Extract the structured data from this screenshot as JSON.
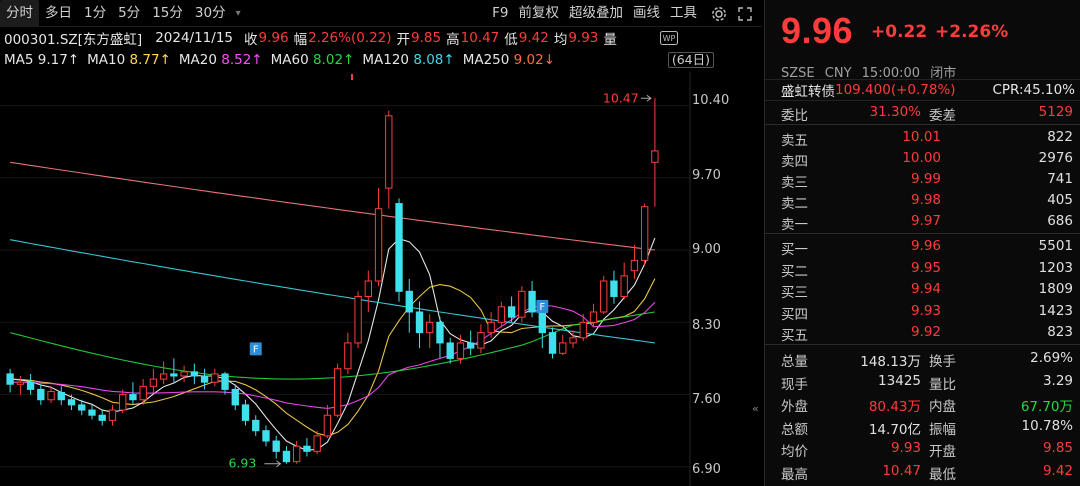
{
  "toolbar": {
    "tabs": [
      "分时",
      "多日",
      "1分",
      "5分",
      "15分",
      "30分"
    ],
    "more": "▾",
    "right_items": [
      "F9",
      "前复权",
      "超级叠加",
      "画线",
      "工具"
    ]
  },
  "info": {
    "code": "000301.SZ[东方盛虹]",
    "date": "2024/11/15",
    "close_label": "收",
    "close": "9.96",
    "range_label": "幅",
    "range": "2.26%(0.22)",
    "open_label": "开",
    "open": "9.85",
    "high_label": "高",
    "high": "10.47",
    "low_label": "低",
    "low": "9.42",
    "avg_label": "均",
    "avg": "9.93",
    "vol_label": "量"
  },
  "ma": [
    {
      "label": "MA5",
      "value": "9.17↑",
      "color": "#ffffff"
    },
    {
      "label": "MA10",
      "value": "8.77↑",
      "color": "#ffd84d"
    },
    {
      "label": "MA20",
      "value": "8.52↑",
      "color": "#ff4dff"
    },
    {
      "label": "MA60",
      "value": "8.02↑",
      "color": "#26d940"
    },
    {
      "label": "MA120",
      "value": "8.08↑",
      "color": "#3ed8e8"
    },
    {
      "label": "MA250",
      "value": "9.02↓",
      "color": "#ff6b3b"
    }
  ],
  "days_button": "(64日)",
  "chart_data": {
    "type": "candlestick",
    "y_ticks": [
      "10.40",
      "9.70",
      "9.00",
      "8.30",
      "7.60",
      "6.90"
    ],
    "high_mark": "10.47",
    "low_mark": "6.93",
    "candles": [
      [
        7.8,
        7.7,
        7.85,
        7.62
      ],
      [
        7.7,
        7.72,
        7.78,
        7.6
      ],
      [
        7.72,
        7.65,
        7.8,
        7.6
      ],
      [
        7.65,
        7.55,
        7.7,
        7.5
      ],
      [
        7.55,
        7.63,
        7.68,
        7.52
      ],
      [
        7.62,
        7.55,
        7.68,
        7.5
      ],
      [
        7.55,
        7.5,
        7.6,
        7.45
      ],
      [
        7.5,
        7.45,
        7.55,
        7.4
      ],
      [
        7.45,
        7.4,
        7.5,
        7.36
      ],
      [
        7.4,
        7.35,
        7.45,
        7.3
      ],
      [
        7.35,
        7.45,
        7.5,
        7.3
      ],
      [
        7.45,
        7.6,
        7.65,
        7.42
      ],
      [
        7.6,
        7.55,
        7.72,
        7.5
      ],
      [
        7.55,
        7.68,
        7.75,
        7.5
      ],
      [
        7.68,
        7.75,
        7.85,
        7.62
      ],
      [
        7.75,
        7.8,
        7.92,
        7.7
      ],
      [
        7.8,
        7.78,
        7.95,
        7.72
      ],
      [
        7.78,
        7.82,
        7.88,
        7.72
      ],
      [
        7.82,
        7.78,
        7.9,
        7.7
      ],
      [
        7.78,
        7.72,
        7.85,
        7.65
      ],
      [
        7.72,
        7.8,
        7.85,
        7.68
      ],
      [
        7.8,
        7.65,
        7.82,
        7.6
      ],
      [
        7.65,
        7.5,
        7.7,
        7.45
      ],
      [
        7.5,
        7.35,
        7.55,
        7.3
      ],
      [
        7.35,
        7.25,
        7.4,
        7.2
      ],
      [
        7.25,
        7.15,
        7.3,
        7.1
      ],
      [
        7.15,
        7.05,
        7.2,
        6.98
      ],
      [
        7.05,
        6.95,
        7.1,
        6.93
      ],
      [
        6.95,
        7.1,
        7.15,
        6.93
      ],
      [
        7.1,
        7.05,
        7.18,
        7.0
      ],
      [
        7.05,
        7.2,
        7.25,
        7.02
      ],
      [
        7.2,
        7.4,
        7.5,
        7.18
      ],
      [
        7.4,
        7.85,
        7.9,
        7.38
      ],
      [
        7.85,
        8.1,
        8.2,
        7.8
      ],
      [
        8.1,
        8.55,
        8.6,
        8.05
      ],
      [
        8.55,
        8.7,
        8.8,
        8.4
      ],
      [
        8.7,
        9.4,
        9.6,
        8.65
      ],
      [
        9.6,
        10.3,
        10.35,
        9.4
      ],
      [
        9.45,
        8.6,
        9.5,
        8.5
      ],
      [
        8.6,
        8.4,
        8.72,
        8.2
      ],
      [
        8.4,
        8.2,
        8.5,
        8.05
      ],
      [
        8.2,
        8.3,
        8.38,
        8.05
      ],
      [
        8.3,
        8.1,
        8.35,
        7.95
      ],
      [
        8.1,
        7.95,
        8.15,
        7.9
      ],
      [
        7.95,
        8.1,
        8.18,
        7.9
      ],
      [
        8.1,
        8.05,
        8.22,
        7.98
      ],
      [
        8.05,
        8.2,
        8.28,
        8.0
      ],
      [
        8.2,
        8.3,
        8.4,
        8.15
      ],
      [
        8.3,
        8.45,
        8.5,
        8.25
      ],
      [
        8.45,
        8.35,
        8.55,
        8.3
      ],
      [
        8.35,
        8.6,
        8.65,
        8.3
      ],
      [
        8.6,
        8.4,
        8.7,
        8.35
      ],
      [
        8.4,
        8.2,
        8.45,
        8.05
      ],
      [
        8.2,
        8.0,
        8.25,
        7.95
      ],
      [
        8.0,
        8.1,
        8.18,
        7.98
      ],
      [
        8.1,
        8.15,
        8.22,
        8.05
      ],
      [
        8.15,
        8.3,
        8.38,
        8.12
      ],
      [
        8.3,
        8.4,
        8.48,
        8.25
      ],
      [
        8.4,
        8.7,
        8.75,
        8.38
      ],
      [
        8.7,
        8.55,
        8.8,
        8.48
      ],
      [
        8.55,
        8.75,
        8.88,
        8.52
      ],
      [
        8.8,
        8.9,
        9.05,
        8.72
      ],
      [
        8.9,
        9.42,
        9.45,
        8.85
      ],
      [
        9.85,
        9.96,
        10.47,
        9.42
      ]
    ]
  },
  "quote": {
    "price": "9.96",
    "change": "+0.22",
    "change_pct": "+2.26%",
    "exchange": "SZSE",
    "currency": "CNY",
    "time": "15:00:00",
    "status": "闭市",
    "cb_name": "盛虹转债",
    "cb_price": "109.400(+0.78%)",
    "cpr": "CPR:45.10%",
    "weibi_label": "委比",
    "weibi": "31.30%",
    "weicha_label": "委差",
    "weicha": "5129"
  },
  "asks": [
    {
      "label": "卖五",
      "price": "10.01",
      "vol": "822"
    },
    {
      "label": "卖四",
      "price": "10.00",
      "vol": "2976"
    },
    {
      "label": "卖三",
      "price": "9.99",
      "vol": "741"
    },
    {
      "label": "卖二",
      "price": "9.98",
      "vol": "405"
    },
    {
      "label": "卖一",
      "price": "9.97",
      "vol": "686"
    }
  ],
  "bids": [
    {
      "label": "买一",
      "price": "9.96",
      "vol": "5501"
    },
    {
      "label": "买二",
      "price": "9.95",
      "vol": "1203"
    },
    {
      "label": "买三",
      "price": "9.94",
      "vol": "1809"
    },
    {
      "label": "买四",
      "price": "9.93",
      "vol": "1423"
    },
    {
      "label": "买五",
      "price": "9.92",
      "vol": "823"
    }
  ],
  "stats": [
    {
      "l1": "总量",
      "v1": "148.13万",
      "c1": "#e0e0e0",
      "l2": "换手",
      "v2": "2.69%",
      "c2": "#e0e0e0"
    },
    {
      "l1": "现手",
      "v1": "13425",
      "c1": "#e0e0e0",
      "l2": "量比",
      "v2": "3.29",
      "c2": "#e0e0e0"
    },
    {
      "l1": "外盘",
      "v1": "80.43万",
      "c1": "#ff3b3b",
      "l2": "内盘",
      "v2": "67.70万",
      "c2": "#26d940"
    },
    {
      "l1": "总额",
      "v1": "14.70亿",
      "c1": "#e0e0e0",
      "l2": "振幅",
      "v2": "10.78%",
      "c2": "#e0e0e0"
    },
    {
      "l1": "均价",
      "v1": "9.93",
      "c1": "#ff3b3b",
      "l2": "开盘",
      "v2": "9.85",
      "c2": "#ff3b3b"
    },
    {
      "l1": "最高",
      "v1": "10.47",
      "c1": "#ff3b3b",
      "l2": "最低",
      "v2": "9.42",
      "c2": "#ff3b3b"
    }
  ]
}
